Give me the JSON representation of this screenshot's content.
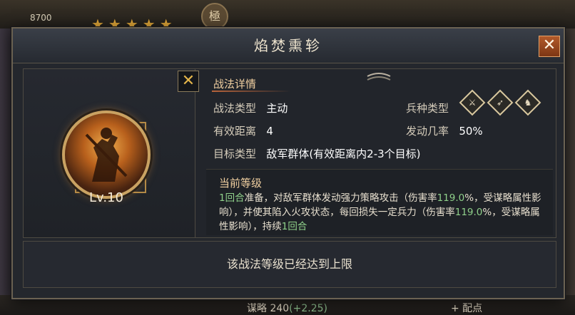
{
  "background": {
    "score": "8700",
    "stars": "★★★★★",
    "emblem": "極",
    "bottom_stat_label": "谋略 240",
    "bottom_stat_bonus": "(+2.25)",
    "bottom_button": "+ 配点"
  },
  "dialog": {
    "title": "焰焚熏轸",
    "close_label": "✕",
    "level_badge": "Lv.10",
    "x_label": "✕",
    "section_title": "战法详情",
    "tactic_type_label": "战法类型",
    "tactic_type_value": "主动",
    "range_label": "有效距离",
    "range_value": "4",
    "target_label": "目标类型",
    "target_value": "敌军群体(有效距离内2-3个目标)",
    "troop_type_label": "兵种类型",
    "trigger_rate_label": "发动几率",
    "trigger_rate_value": "50%",
    "troop_icons": [
      "spear-troop-icon",
      "archer-troop-icon",
      "cavalry-troop-icon"
    ],
    "current_level_title": "当前等级",
    "desc": {
      "p1": "1回合",
      "p2": "准备，对敌军群体发动强力策略攻击（伤害率",
      "p3": "119.0",
      "p4": "%，受谋略属性影响），并使其陷入火攻状态，每回损失一定兵力（伤害率",
      "p5": "119.0",
      "p6": "%，受谋略属性影响），持续",
      "p7": "1回合"
    },
    "footer_text": "该战法等级已经达到上限"
  },
  "colors": {
    "accent": "#f0cfa0",
    "highlight_green": "#8fd08a",
    "close_orange": "#b35a2a"
  }
}
